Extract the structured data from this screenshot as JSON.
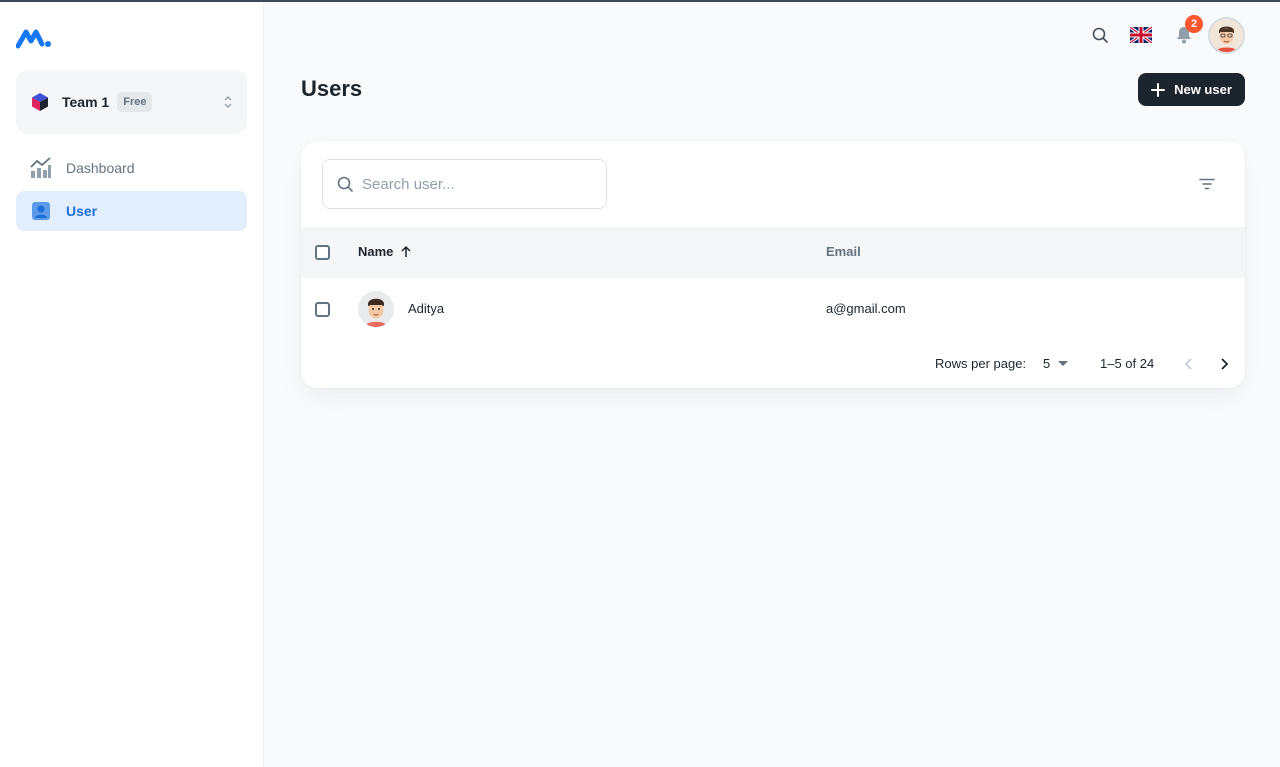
{
  "sidebar": {
    "team": {
      "name": "Team 1",
      "plan": "Free"
    },
    "items": [
      {
        "label": "Dashboard",
        "icon": "chart-icon"
      },
      {
        "label": "User",
        "icon": "user-icon",
        "active": true
      }
    ]
  },
  "header": {
    "notifications_count": "2",
    "language": "English (UK)"
  },
  "main": {
    "title": "Users",
    "new_user_label": "New user",
    "search": {
      "placeholder": "Search user...",
      "value": ""
    },
    "table": {
      "columns": [
        "Name",
        "Email"
      ],
      "sort": {
        "column": "Name",
        "direction": "asc"
      },
      "rows": [
        {
          "name": "Aditya",
          "email": "a@gmail.com"
        }
      ]
    },
    "pagination": {
      "rows_per_page_label": "Rows per page:",
      "rows_per_page": "5",
      "range": "1–5 of 24"
    }
  },
  "colors": {
    "accent": "#1e6fd9",
    "primary_dark": "#1c252e",
    "badge": "#ff5630"
  }
}
